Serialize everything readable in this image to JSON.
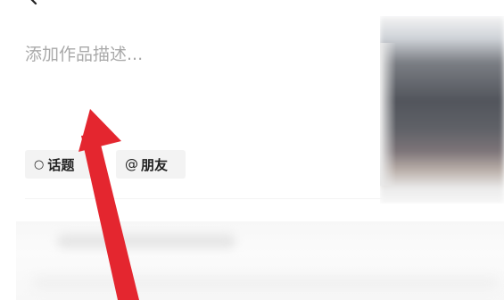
{
  "description": {
    "placeholder": "添加作品描述...",
    "value": ""
  },
  "chips": {
    "topic": {
      "icon": "○",
      "label": "话题",
      "icon_name": "hash-circle-icon"
    },
    "friend": {
      "icon": "@",
      "label": "朋友",
      "icon_name": "at-icon"
    }
  },
  "icons": {
    "back": "back-chevron-icon"
  },
  "colors": {
    "annotation_arrow": "#e4262f",
    "placeholder_text": "#a9a9a9",
    "chip_background": "#f3f3f3"
  }
}
